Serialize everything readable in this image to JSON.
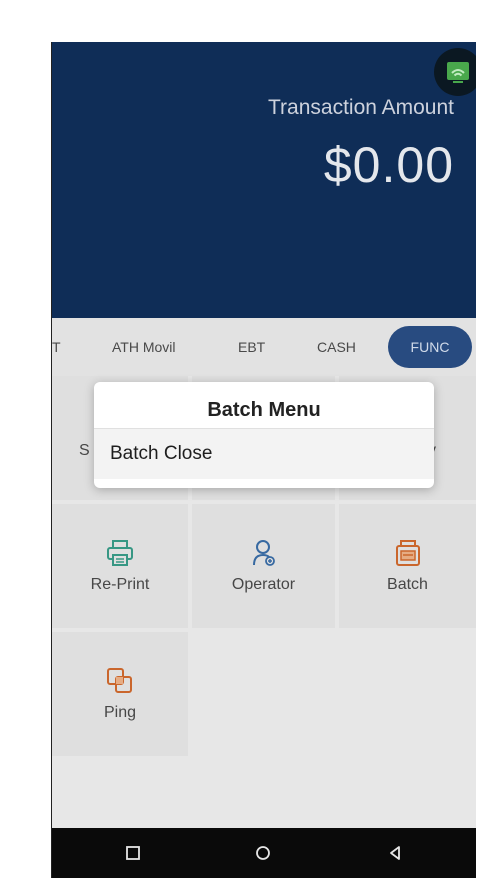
{
  "header": {
    "amount_label": "Transaction Amount",
    "amount_value": "$0.00",
    "status_icon": "terminal-status-icon"
  },
  "tabs": {
    "items": [
      "T",
      "ATH Movil",
      "EBT",
      "CASH"
    ],
    "active": "FUNC"
  },
  "grid": {
    "hidden_left_partial": "S",
    "hidden_right_partial": "y",
    "items": [
      {
        "label": "Re-Print",
        "icon": "printer-icon",
        "color": "#3a9e8a"
      },
      {
        "label": "Operator",
        "icon": "operator-icon",
        "color": "#3a6ea8"
      },
      {
        "label": "Batch",
        "icon": "batch-icon",
        "color": "#d36b2e"
      },
      {
        "label": "Ping",
        "icon": "ping-icon",
        "color": "#d36b2e"
      }
    ]
  },
  "dialog": {
    "title": "Batch Menu",
    "items": [
      "Batch Close"
    ]
  },
  "navbar": {
    "square": "square-icon",
    "home": "circle-icon",
    "back": "back-triangle-icon"
  },
  "colors": {
    "header_bg": "#102f5b",
    "active_tab_bg": "#2a4f86"
  }
}
